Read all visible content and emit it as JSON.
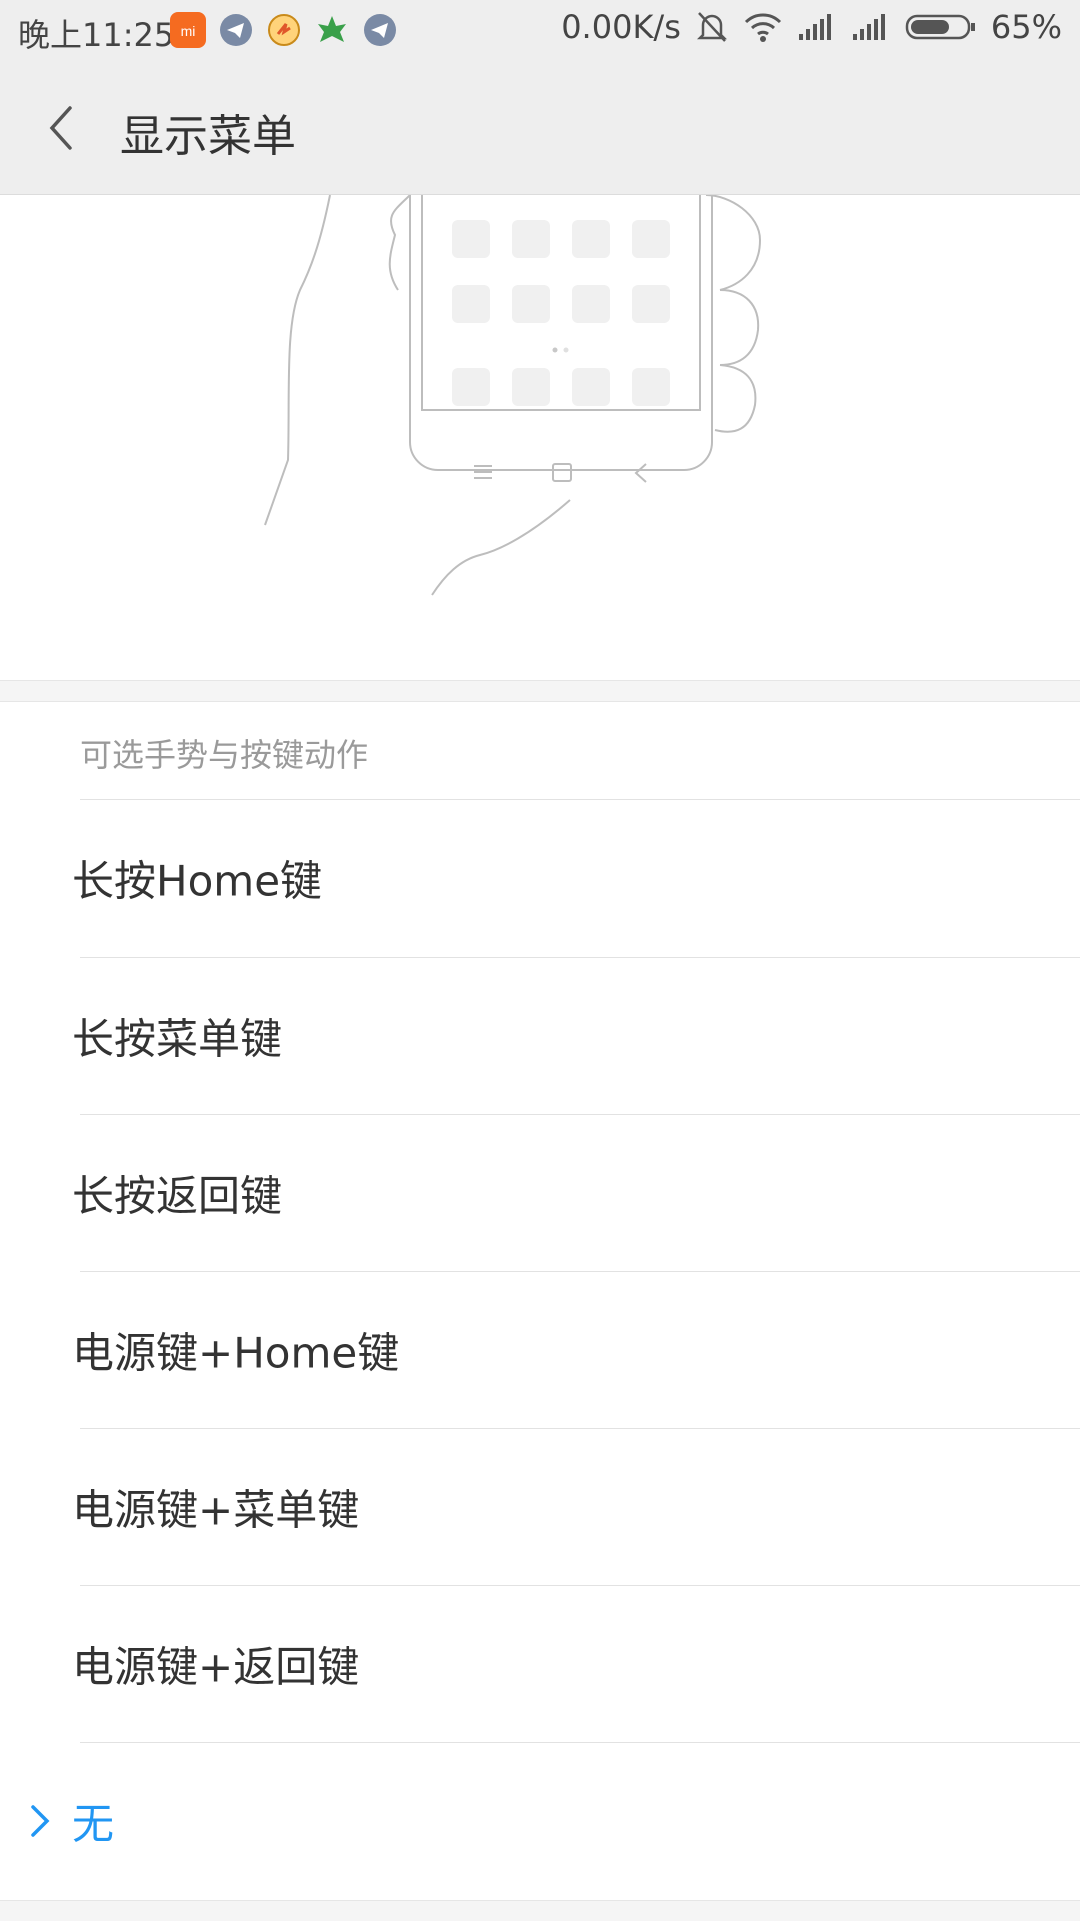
{
  "status_bar": {
    "time": "晚上11:25",
    "speed": "0.00K/s",
    "battery": "65%",
    "apps": [
      "mi-app-icon",
      "telegram-icon",
      "tasker-icon",
      "greenify-icon",
      "telegram-icon"
    ]
  },
  "header": {
    "title": "显示菜单",
    "back_icon": "chevron-left-icon"
  },
  "section": {
    "title": "可选手势与按键动作"
  },
  "options": [
    {
      "label": "长按Home键",
      "selected": false
    },
    {
      "label": "长按菜单键",
      "selected": false
    },
    {
      "label": "长按返回键",
      "selected": false
    },
    {
      "label": "电源键+Home键",
      "selected": false
    },
    {
      "label": "电源键+菜单键",
      "selected": false
    },
    {
      "label": "电源键+返回键",
      "selected": false
    },
    {
      "label": "无",
      "selected": true
    }
  ],
  "colors": {
    "accent": "#2196f3",
    "header_bg": "#eeeeee",
    "text": "#333333",
    "muted": "#9a9a9a"
  }
}
